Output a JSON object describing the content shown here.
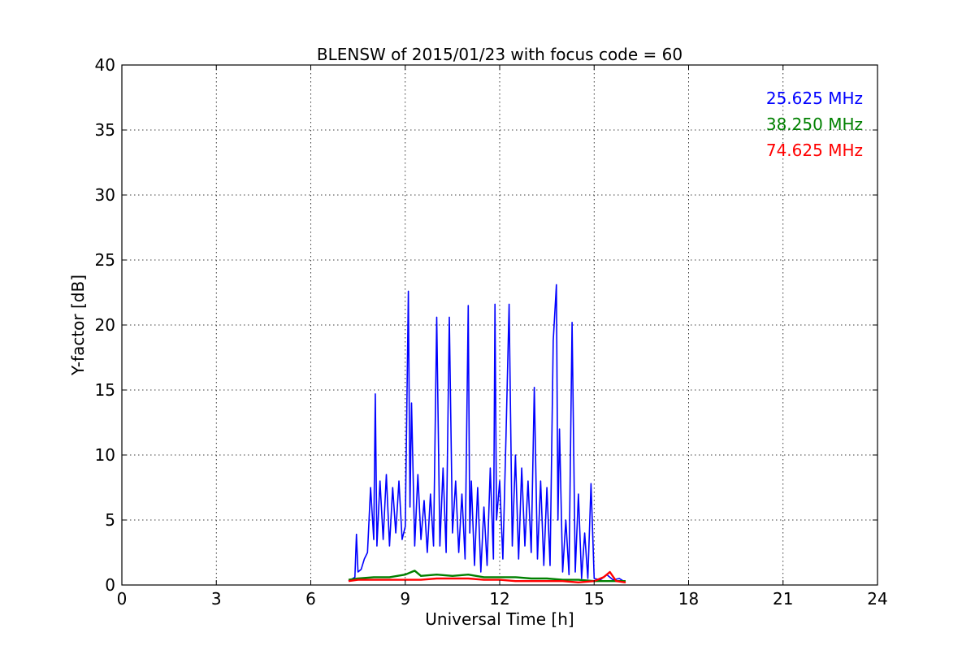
{
  "chart_data": {
    "type": "line",
    "title": "BLENSW of 2015/01/23 with focus code = 60",
    "xlabel": "Universal Time [h]",
    "ylabel": "Y-factor [dB]",
    "xlim": [
      0,
      24
    ],
    "ylim": [
      0,
      40
    ],
    "xticks": [
      0,
      3,
      6,
      9,
      12,
      15,
      18,
      21,
      24
    ],
    "yticks": [
      0,
      5,
      10,
      15,
      20,
      25,
      30,
      35,
      40
    ],
    "grid": true,
    "legend_position": "top-right",
    "series": [
      {
        "name": "25.625 MHz",
        "color": "#0000ff",
        "x": [
          7.2,
          7.4,
          7.45,
          7.5,
          7.6,
          7.7,
          7.8,
          7.9,
          8.0,
          8.05,
          8.1,
          8.2,
          8.3,
          8.4,
          8.5,
          8.6,
          8.7,
          8.8,
          8.9,
          9.0,
          9.1,
          9.15,
          9.2,
          9.3,
          9.4,
          9.5,
          9.6,
          9.7,
          9.8,
          9.9,
          10.0,
          10.1,
          10.2,
          10.3,
          10.4,
          10.5,
          10.6,
          10.7,
          10.8,
          10.9,
          11.0,
          11.05,
          11.1,
          11.2,
          11.3,
          11.4,
          11.5,
          11.6,
          11.7,
          11.8,
          11.85,
          11.9,
          12.0,
          12.1,
          12.2,
          12.3,
          12.4,
          12.5,
          12.6,
          12.7,
          12.8,
          12.9,
          13.0,
          13.1,
          13.2,
          13.3,
          13.4,
          13.5,
          13.6,
          13.7,
          13.8,
          13.85,
          13.9,
          14.0,
          14.1,
          14.2,
          14.3,
          14.4,
          14.5,
          14.6,
          14.7,
          14.8,
          14.9,
          15.0,
          15.2,
          15.4,
          15.6,
          15.8,
          16.0
        ],
        "y": [
          0.3,
          0.6,
          3.9,
          1.0,
          1.2,
          2.0,
          2.5,
          7.5,
          3.5,
          14.7,
          3.0,
          8.0,
          3.5,
          8.5,
          3.0,
          7.5,
          4.0,
          8.0,
          3.5,
          4.5,
          22.6,
          6.0,
          14.0,
          3.0,
          8.5,
          3.5,
          6.5,
          2.5,
          7.0,
          3.0,
          20.6,
          3.0,
          9.0,
          2.5,
          20.6,
          4.0,
          8.0,
          2.5,
          7.0,
          2.0,
          21.5,
          4.0,
          8.0,
          1.5,
          7.5,
          1.0,
          6.0,
          1.5,
          9.0,
          2.0,
          21.6,
          5.0,
          8.0,
          2.0,
          11.5,
          21.6,
          3.0,
          10.0,
          2.0,
          9.0,
          3.0,
          8.0,
          2.5,
          15.2,
          2.0,
          8.0,
          1.5,
          7.5,
          1.5,
          18.8,
          23.1,
          5.0,
          12.0,
          1.0,
          5.0,
          0.8,
          20.2,
          1.0,
          7.0,
          0.5,
          4.0,
          0.5,
          7.8,
          0.5,
          0.4,
          0.8,
          0.4,
          0.5,
          0.2
        ]
      },
      {
        "name": "38.250 MHz",
        "color": "#008000",
        "x": [
          7.2,
          7.5,
          8.0,
          8.5,
          9.0,
          9.3,
          9.5,
          10.0,
          10.5,
          11.0,
          11.5,
          12.0,
          12.5,
          13.0,
          13.5,
          14.0,
          14.5,
          15.0,
          15.5,
          16.0
        ],
        "y": [
          0.4,
          0.5,
          0.6,
          0.6,
          0.8,
          1.1,
          0.7,
          0.8,
          0.7,
          0.8,
          0.6,
          0.6,
          0.6,
          0.5,
          0.5,
          0.4,
          0.4,
          0.3,
          0.3,
          0.3
        ]
      },
      {
        "name": "74.625 MHz",
        "color": "#ff0000",
        "x": [
          7.2,
          7.5,
          8.0,
          8.5,
          9.0,
          9.5,
          10.0,
          10.5,
          11.0,
          11.5,
          12.0,
          12.5,
          13.0,
          13.5,
          14.0,
          14.5,
          15.0,
          15.3,
          15.5,
          15.7,
          16.0
        ],
        "y": [
          0.3,
          0.4,
          0.4,
          0.4,
          0.4,
          0.4,
          0.5,
          0.5,
          0.5,
          0.4,
          0.4,
          0.3,
          0.3,
          0.3,
          0.3,
          0.2,
          0.3,
          0.6,
          1.0,
          0.3,
          0.2
        ]
      }
    ]
  }
}
